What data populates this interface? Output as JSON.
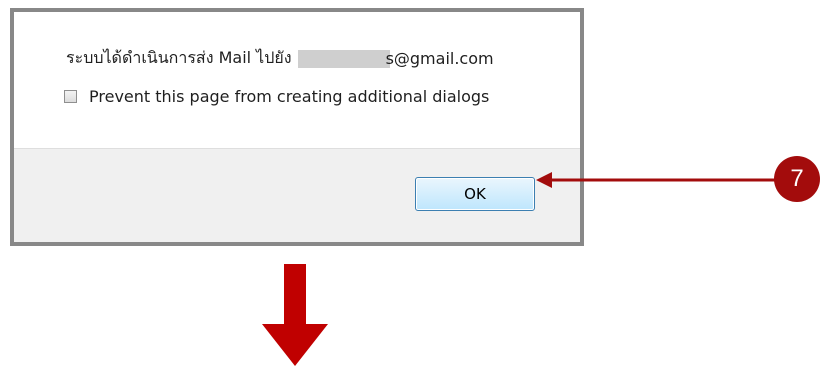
{
  "dialog": {
    "message_prefix": "ระบบได้ดำเนินการส่ง Mail ไปยัง",
    "message_suffix": "s@gmail.com",
    "checkbox_label": "Prevent this page from creating additional dialogs",
    "checkbox_checked": false,
    "ok_label": "OK"
  },
  "annotation": {
    "step_number": "7",
    "accent_color": "#a30c0c"
  }
}
